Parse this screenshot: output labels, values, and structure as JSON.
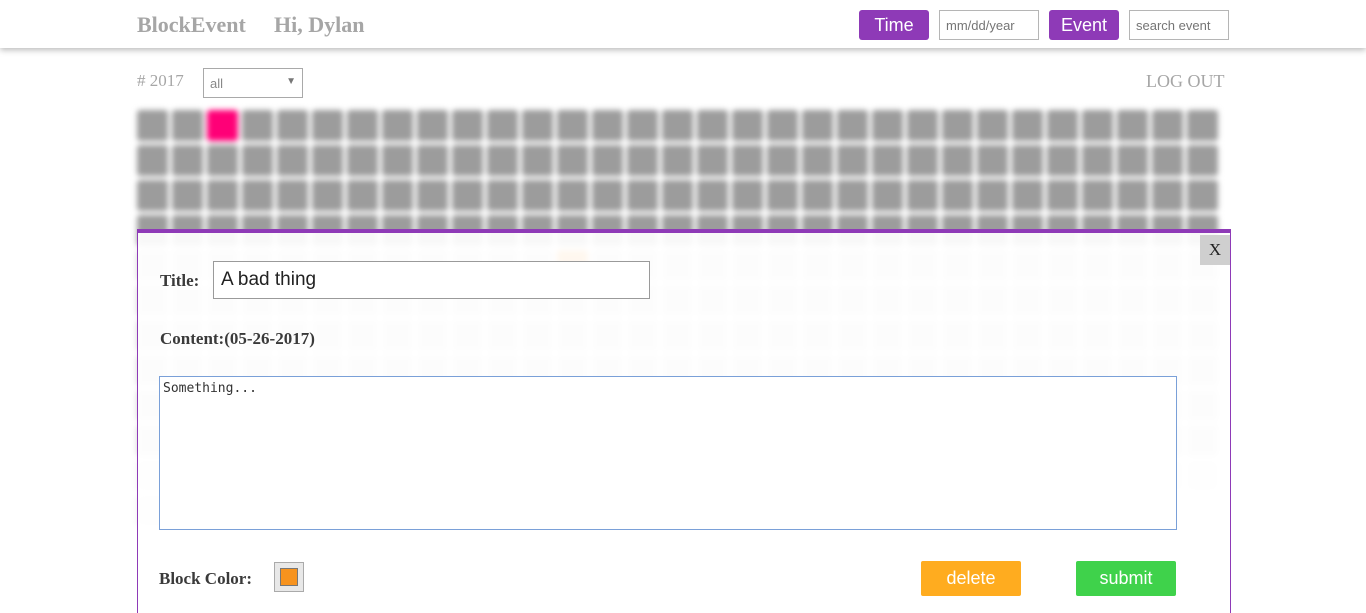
{
  "header": {
    "brand": "BlockEvent",
    "greeting": "Hi, Dylan",
    "time_button": "Time",
    "date_placeholder": "mm/dd/year",
    "event_button": "Event",
    "search_placeholder": "search event"
  },
  "toolbar": {
    "year": "# 2017",
    "filter_value": "all",
    "logout": "LOG OUT"
  },
  "colors": {
    "accent": "#8e3ab7",
    "block_default": "#9c9c9c",
    "block_pink": "#ff0077",
    "block_orange": "#f7931e",
    "delete": "#ffac1f",
    "submit": "#3fd24b"
  },
  "modal": {
    "close_label": "X",
    "title_label": "Title:",
    "title_value": "A bad thing",
    "content_label": "Content:(05-26-2017)",
    "content_value": "Something...",
    "color_label": "Block Color:",
    "delete_label": "delete",
    "submit_label": "submit"
  }
}
